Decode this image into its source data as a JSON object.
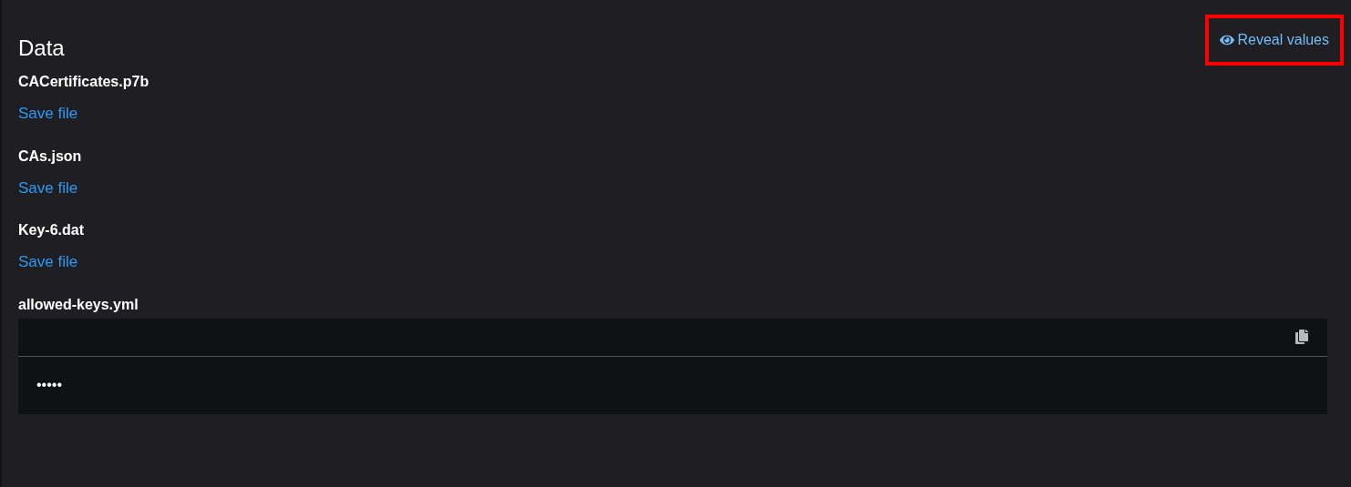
{
  "title": "Data",
  "reveal_button": {
    "label": "Reveal values",
    "highlighted": true
  },
  "entries": [
    {
      "kind": "file",
      "name": "CACertificates.p7b",
      "action": "Save file"
    },
    {
      "kind": "file",
      "name": "CAs.json",
      "action": "Save file"
    },
    {
      "kind": "file",
      "name": "Key-6.dat",
      "action": "Save file"
    },
    {
      "kind": "text",
      "name": "allowed-keys.yml",
      "value": "•••••"
    }
  ]
}
